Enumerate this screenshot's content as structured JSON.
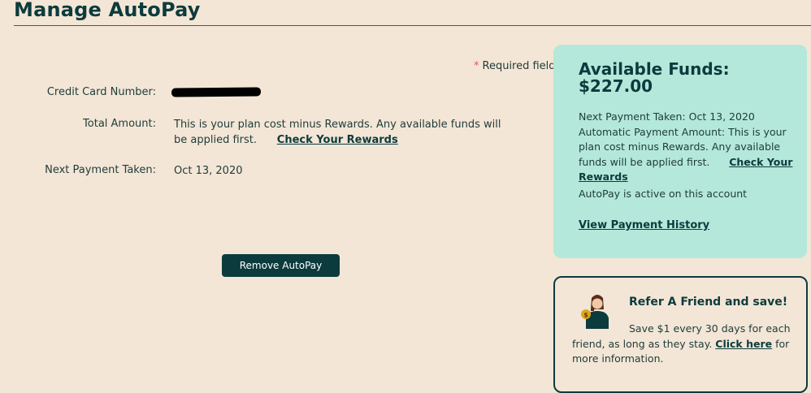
{
  "page": {
    "title": "Manage AutoPay",
    "required_star": "*",
    "required_text": "Required fields"
  },
  "form": {
    "credit_card_label": "Credit Card Number:",
    "total_amount_label": "Total Amount:",
    "total_amount_text": "This is your plan cost minus Rewards. Any available funds will be applied first.",
    "check_rewards_link": "Check Your Rewards",
    "next_payment_label": "Next Payment Taken:",
    "next_payment_value": "Oct 13, 2020",
    "remove_button": "Remove AutoPay"
  },
  "funds": {
    "title_line1": "Available Funds:",
    "title_line2": "$227.00",
    "next_payment": "Next Payment Taken: Oct 13, 2020",
    "auto_amount_text": "Automatic Payment Amount: This is your plan cost minus Rewards. Any available funds will be applied first.",
    "check_rewards_link": "Check Your Rewards",
    "active_text": "AutoPay is active on this account",
    "history_link": "View Payment History",
    "bg_color": "#b4e8da"
  },
  "refer": {
    "title": "Refer A Friend and save!",
    "text_before": "Save $1 every 30 days for each friend, as long as they stay.",
    "link": "Click here",
    "text_after": "for more information.",
    "avatar_icon": "person-with-coin-icon",
    "coin_symbol": "$"
  },
  "colors": {
    "primary": "#0c3b3d",
    "background": "#f3e6d6",
    "required": "#e05a5a"
  }
}
